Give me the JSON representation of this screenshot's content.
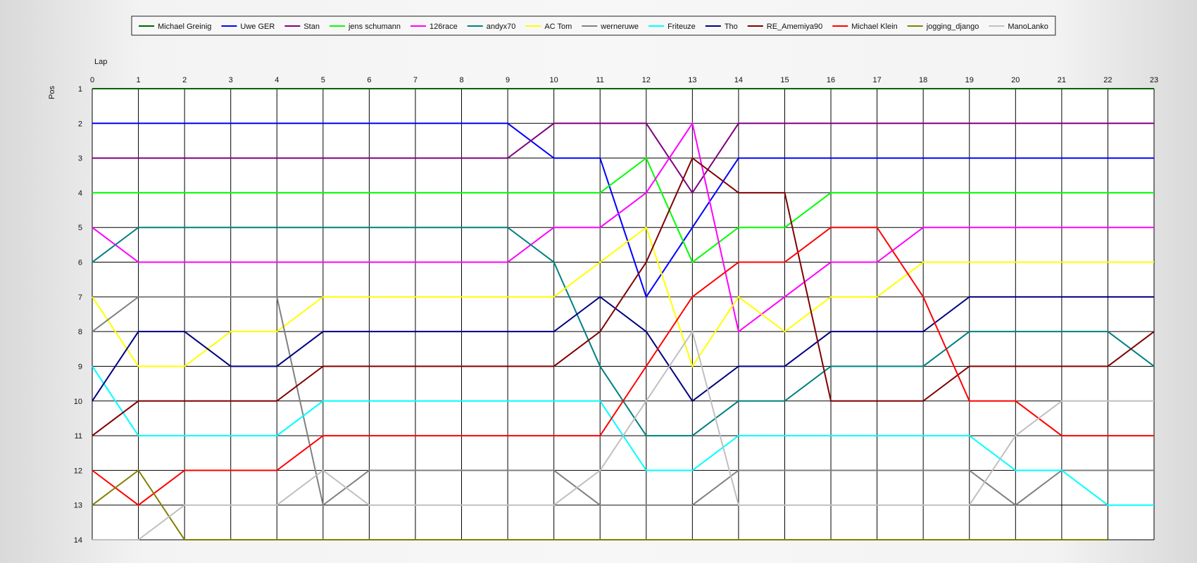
{
  "chart_data": {
    "type": "line",
    "title": "",
    "xlabel": "Lap",
    "ylabel": "Pos",
    "x": [
      0,
      1,
      2,
      3,
      4,
      5,
      6,
      7,
      8,
      9,
      10,
      11,
      12,
      13,
      14,
      15,
      16,
      17,
      18,
      19,
      20,
      21,
      22,
      23
    ],
    "xlim": [
      0,
      23
    ],
    "ylim": [
      1,
      14
    ],
    "y_inverted": true,
    "y_ticks": [
      1,
      2,
      3,
      4,
      5,
      6,
      7,
      8,
      9,
      10,
      11,
      12,
      13,
      14
    ],
    "grid": true,
    "legend_position": "top",
    "series": [
      {
        "name": "Michael Greinig",
        "color": "#006400",
        "values": [
          1,
          1,
          1,
          1,
          1,
          1,
          1,
          1,
          1,
          1,
          1,
          1,
          1,
          1,
          1,
          1,
          1,
          1,
          1,
          1,
          1,
          1,
          1,
          1
        ]
      },
      {
        "name": "Uwe GER",
        "color": "#0000ff",
        "values": [
          2,
          2,
          2,
          2,
          2,
          2,
          2,
          2,
          2,
          2,
          3,
          3,
          7,
          5,
          3,
          3,
          3,
          3,
          3,
          3,
          3,
          3,
          3,
          3
        ]
      },
      {
        "name": "Stan",
        "color": "#800080",
        "values": [
          3,
          3,
          3,
          3,
          3,
          3,
          3,
          3,
          3,
          3,
          2,
          2,
          2,
          4,
          2,
          2,
          2,
          2,
          2,
          2,
          2,
          2,
          2,
          2
        ]
      },
      {
        "name": "jens  schumann",
        "color": "#00ff00",
        "values": [
          4,
          4,
          4,
          4,
          4,
          4,
          4,
          4,
          4,
          4,
          4,
          4,
          3,
          6,
          5,
          5,
          4,
          4,
          4,
          4,
          4,
          4,
          4,
          4
        ]
      },
      {
        "name": "126race",
        "color": "#ff00ff",
        "values": [
          5,
          6,
          6,
          6,
          6,
          6,
          6,
          6,
          6,
          6,
          5,
          5,
          4,
          2,
          8,
          7,
          6,
          6,
          5,
          5,
          5,
          5,
          5,
          5
        ]
      },
      {
        "name": "andyx70",
        "color": "#008080",
        "values": [
          6,
          5,
          5,
          5,
          5,
          5,
          5,
          5,
          5,
          5,
          6,
          9,
          11,
          11,
          10,
          10,
          9,
          9,
          9,
          8,
          8,
          8,
          8,
          9
        ]
      },
      {
        "name": "AC Tom",
        "color": "#ffff00",
        "values": [
          7,
          9,
          9,
          8,
          8,
          7,
          7,
          7,
          7,
          7,
          7,
          6,
          5,
          9,
          7,
          8,
          7,
          7,
          6,
          6,
          6,
          6,
          6,
          6
        ]
      },
      {
        "name": "werneruwe",
        "color": "#808080",
        "values": [
          8,
          7,
          7,
          7,
          7,
          13,
          12,
          12,
          12,
          12,
          12,
          13,
          13,
          13,
          12,
          12,
          12,
          12,
          12,
          12,
          13,
          12,
          12,
          12
        ]
      },
      {
        "name": "Friteuze",
        "color": "#00ffff",
        "values": [
          9,
          11,
          11,
          11,
          11,
          10,
          10,
          10,
          10,
          10,
          10,
          10,
          12,
          12,
          11,
          11,
          11,
          11,
          11,
          11,
          12,
          12,
          13,
          13
        ]
      },
      {
        "name": "Tho",
        "color": "#000080",
        "values": [
          10,
          8,
          8,
          9,
          9,
          8,
          8,
          8,
          8,
          8,
          8,
          7,
          8,
          10,
          9,
          9,
          8,
          8,
          8,
          7,
          7,
          7,
          7,
          7
        ]
      },
      {
        "name": "RE_Amemiya90",
        "color": "#800000",
        "values": [
          11,
          10,
          10,
          10,
          10,
          9,
          9,
          9,
          9,
          9,
          9,
          8,
          6,
          3,
          4,
          4,
          10,
          10,
          10,
          9,
          9,
          9,
          9,
          8
        ]
      },
      {
        "name": "Michael Klein",
        "color": "#ff0000",
        "values": [
          12,
          13,
          12,
          12,
          12,
          11,
          11,
          11,
          11,
          11,
          11,
          11,
          9,
          7,
          6,
          6,
          5,
          5,
          7,
          10,
          10,
          11,
          11,
          11
        ]
      },
      {
        "name": "jogging_django",
        "color": "#808000",
        "values": [
          13,
          12,
          14,
          14,
          14,
          14,
          14,
          14,
          14,
          14,
          14,
          14,
          14,
          14,
          14,
          14,
          14,
          14,
          14,
          14,
          14,
          14,
          14,
          null
        ]
      },
      {
        "name": "ManoLanko",
        "color": "#c0c0c0",
        "values": [
          14,
          14,
          13,
          13,
          13,
          12,
          13,
          13,
          13,
          13,
          13,
          12,
          10,
          8,
          13,
          13,
          13,
          13,
          13,
          13,
          11,
          10,
          10,
          10
        ]
      }
    ]
  }
}
